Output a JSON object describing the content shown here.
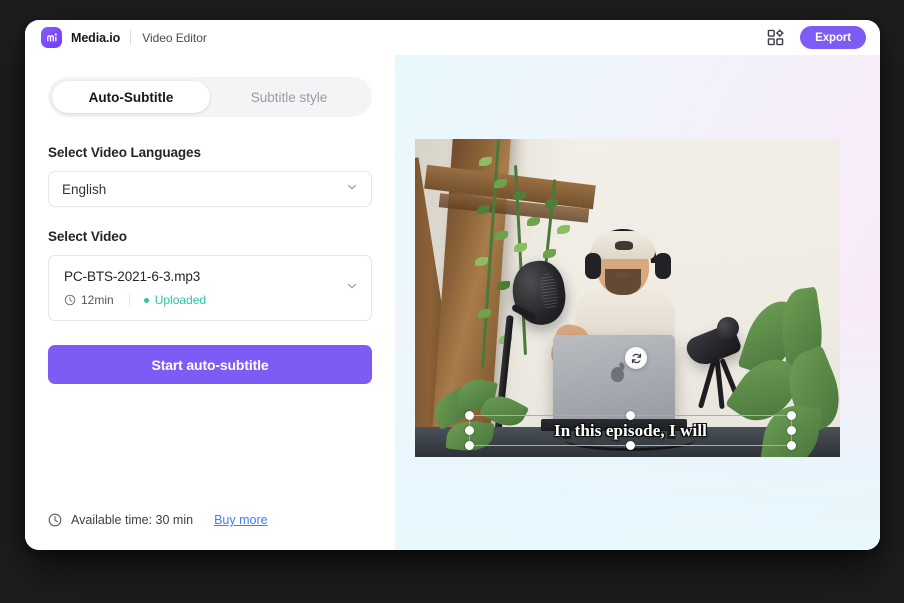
{
  "window": {
    "topbar": {
      "logo_icon": "mediaio-logo-icon",
      "brand_name": "Media.io",
      "app_section": "Video Editor",
      "grid_icon": "template-grid-icon",
      "export_label": "Export"
    }
  },
  "left_panel": {
    "tabs": [
      {
        "label": "Auto-Subtitle",
        "active": true
      },
      {
        "label": "Subtitle style",
        "active": false
      }
    ],
    "language_section": {
      "label": "Select Video Languages",
      "selected": "English",
      "chevron_icon": "chevron-down-icon"
    },
    "video_section": {
      "label": "Select Video",
      "file_name": "PC-BTS-2021-6-3.mp3",
      "clock_icon": "clock-icon",
      "duration": "12min",
      "status": "Uploaded",
      "status_dot_color": "#2ec4a0",
      "chevron_icon": "chevron-down-icon"
    },
    "start_button": {
      "label": "Start auto-subtitle",
      "color": "#7d5cf5"
    },
    "footer": {
      "clock_icon": "clock-icon",
      "available_time": "Available time: 30 min",
      "link_label": "Buy more",
      "link_color": "#3b82f6"
    }
  },
  "preview": {
    "rotate_icon": "rotate-refresh-icon",
    "subtitle_text": "In this episode, I will",
    "selection_color": "#eda32e",
    "scene_description": "podcast-recording-studio"
  }
}
